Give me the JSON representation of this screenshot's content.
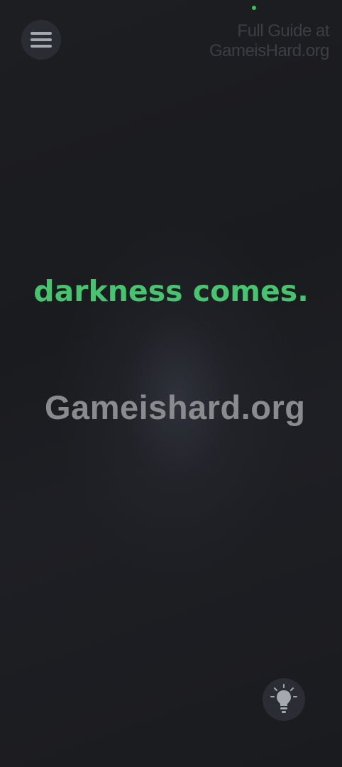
{
  "header": {
    "menu_icon": "hamburger-menu-icon",
    "watermark_line1": "Full Guide at",
    "watermark_line2": "GameisHard.org"
  },
  "main": {
    "story_text": "darkness comes.",
    "center_watermark": "Gameishard.org"
  },
  "footer": {
    "hint_icon": "lightbulb-icon"
  },
  "colors": {
    "background": "#1b1c20",
    "story_text": "#46c46e",
    "status_dot": "#3fbf5a",
    "button_bg": "#2a2c33",
    "icon": "#a6a8b0"
  }
}
